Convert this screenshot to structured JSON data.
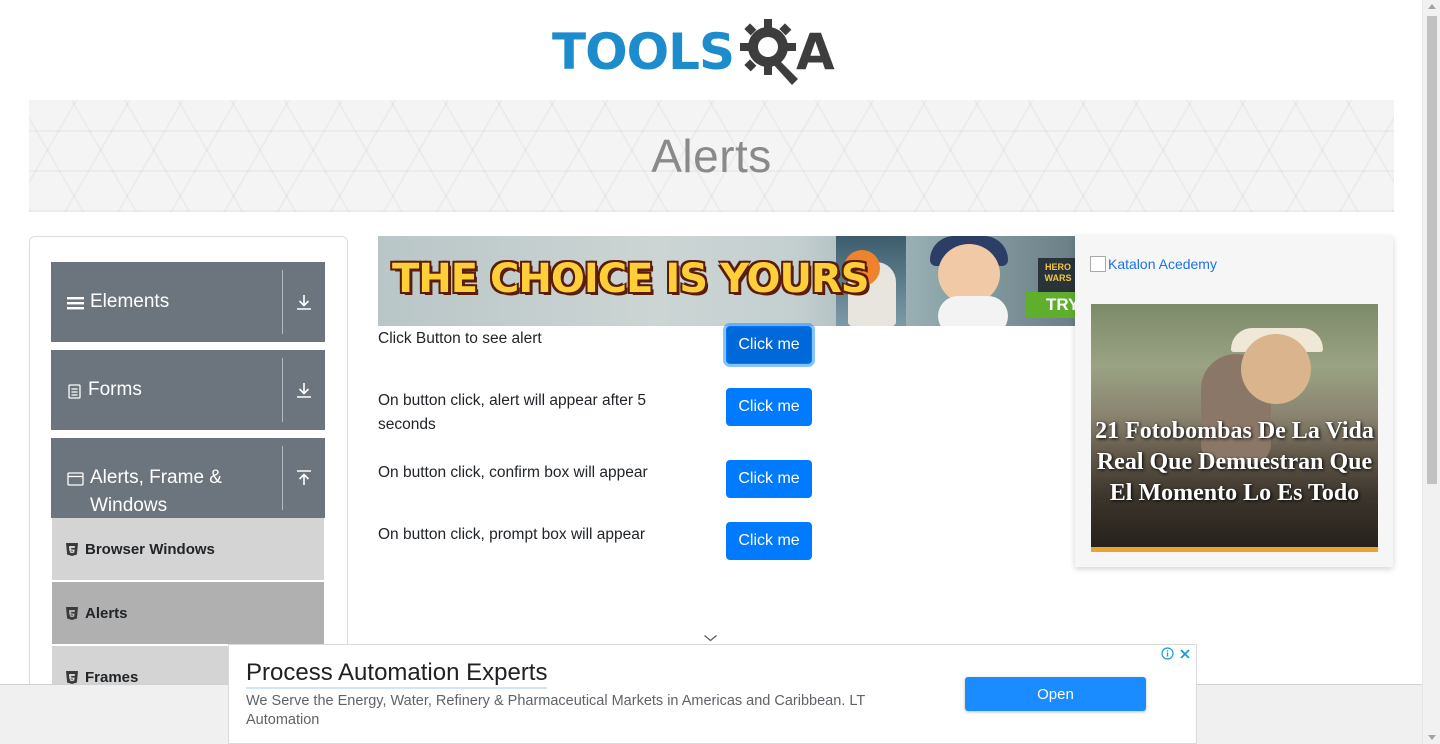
{
  "logo": {
    "text": "TOOLS",
    "suffix": "A",
    "colors": {
      "primary": "#1d8ccd",
      "dark": "#3d3d3d"
    }
  },
  "banner": {
    "title": "Alerts"
  },
  "sidebar": {
    "groups": [
      {
        "label": "Elements",
        "icon": "menu-icon",
        "state": "collapsed"
      },
      {
        "label": "Forms",
        "icon": "document-icon",
        "state": "collapsed"
      },
      {
        "label": "Alerts, Frame & Windows",
        "icon": "window-icon",
        "state": "expanded"
      }
    ],
    "items": [
      {
        "label": "Browser Windows",
        "icon": "html5-icon"
      },
      {
        "label": "Alerts",
        "icon": "html5-icon",
        "active": true
      },
      {
        "label": "Frames",
        "icon": "html5-icon"
      }
    ]
  },
  "top_ad": {
    "headline": "THE CHOICE IS YOURS",
    "badge": "HERO WARS",
    "cta": "TRY"
  },
  "alerts": [
    {
      "label": "Click Button to see alert",
      "button": "Click me"
    },
    {
      "label": "On button click, alert will appear after 5 seconds",
      "button": "Click me"
    },
    {
      "label": "On button click, confirm box will appear",
      "button": "Click me"
    },
    {
      "label": "On button click, prompt box will appear",
      "button": "Click me"
    }
  ],
  "right_ad": {
    "link": "Katalon Acedemy",
    "caption": "21 Fotobombas De La Vida Real Que Demuestran Que El Momento Lo Es Todo"
  },
  "bottom_ad": {
    "title": "Process Automation Experts",
    "description": "We Serve the Energy, Water, Refinery & Pharmaceutical Markets in Americas and Caribbean. LT Automation",
    "cta": "Open"
  },
  "colors": {
    "button": "#007bff",
    "sidebar_group": "#6c757d",
    "sidebar_item": "#d9d9d9",
    "sidebar_item_active": "#b5b5b5"
  }
}
